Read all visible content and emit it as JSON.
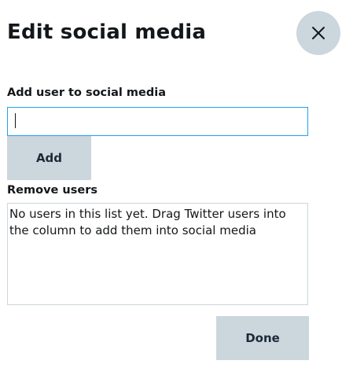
{
  "dialog": {
    "title": "Edit social media",
    "close_icon": "close-icon"
  },
  "add_section": {
    "label": "Add user to social media",
    "input_value": "",
    "add_button_label": "Add"
  },
  "remove_section": {
    "label": "Remove users",
    "empty_message": "No users in this list yet. Drag Twitter users into the column to add them into social media"
  },
  "footer": {
    "done_button_label": "Done"
  },
  "colors": {
    "button_bg": "#ccd6dd",
    "input_focus_border": "#1da1f2",
    "text": "#14171a"
  }
}
